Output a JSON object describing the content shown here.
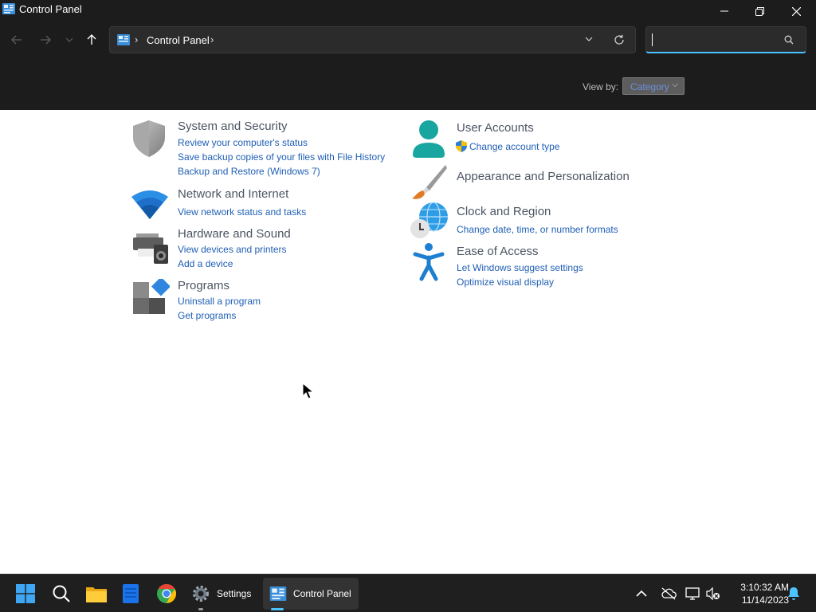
{
  "window": {
    "title": "Control Panel"
  },
  "nav": {
    "breadcrumb_root": "Control Panel",
    "search_placeholder": ""
  },
  "view_by": {
    "label": "View by:",
    "selected": "Category"
  },
  "categories_left": [
    {
      "title": "System and Security",
      "icon": "shield-icon",
      "links": [
        "Review your computer's status",
        "Save backup copies of your files with File History",
        "Backup and Restore (Windows 7)"
      ]
    },
    {
      "title": "Network and Internet",
      "icon": "wifi-icon",
      "links": [
        "View network status and tasks"
      ]
    },
    {
      "title": "Hardware and Sound",
      "icon": "printer-speaker-icon",
      "links": [
        "View devices and printers",
        "Add a device"
      ]
    },
    {
      "title": "Programs",
      "icon": "programs-icon",
      "links": [
        "Uninstall a program",
        "Get programs"
      ]
    }
  ],
  "categories_right": [
    {
      "title": "User Accounts",
      "icon": "user-icon",
      "links": [
        "Change account type"
      ]
    },
    {
      "title": "Appearance and Personalization",
      "icon": "paintbrush-icon",
      "links": []
    },
    {
      "title": "Clock and Region",
      "icon": "globe-clock-icon",
      "links": [
        "Change date, time, or number formats"
      ]
    },
    {
      "title": "Ease of Access",
      "icon": "accessibility-icon",
      "links": [
        "Let Windows suggest settings",
        "Optimize visual display"
      ]
    }
  ],
  "taskbar": {
    "settings_label": "Settings",
    "control_panel_label": "Control Panel",
    "time": "3:10:32 AM",
    "date": "11/14/2023"
  },
  "colors": {
    "accent": "#4cc2ff",
    "link": "#1f5fb5",
    "title_text": "#4c5563",
    "chrome_bg": "#1c1c1c"
  }
}
